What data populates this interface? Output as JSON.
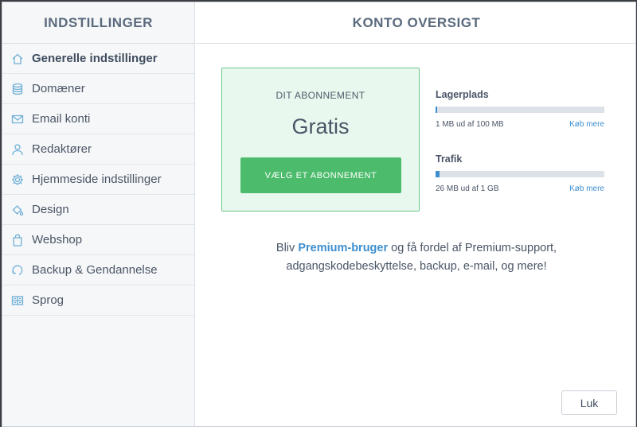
{
  "sidebar": {
    "title": "INDSTILLINGER",
    "items": [
      {
        "label": "Generelle indstillinger",
        "icon": "home-icon"
      },
      {
        "label": "Domæner",
        "icon": "database-icon"
      },
      {
        "label": "Email konti",
        "icon": "envelope-icon"
      },
      {
        "label": "Redaktører",
        "icon": "user-icon"
      },
      {
        "label": "Hjemmeside indstillinger",
        "icon": "gear-icon"
      },
      {
        "label": "Design",
        "icon": "paint-bucket-icon"
      },
      {
        "label": "Webshop",
        "icon": "shopping-bag-icon"
      },
      {
        "label": "Backup & Gendannelse",
        "icon": "backup-icon"
      },
      {
        "label": "Sprog",
        "icon": "language-icon"
      }
    ]
  },
  "main": {
    "title": "KONTO OVERSIGT",
    "plan": {
      "label": "DIT ABONNEMENT",
      "name": "Gratis",
      "button": "VÆLG ET ABONNEMENT"
    },
    "storage": {
      "title": "Lagerplads",
      "text": "1 MB ud af 100 MB",
      "link": "Køb mere",
      "fraction": 0.01
    },
    "traffic": {
      "title": "Trafik",
      "text": "26 MB ud af 1 GB",
      "link": "Køb mere",
      "fraction": 0.025
    },
    "promo": {
      "before": "Bliv ",
      "strong": "Premium-bruger",
      "after": " og få fordel af Premium-support, adgangskodebeskyttelse, backup, e-mail, og mere!"
    },
    "close": "Luk"
  },
  "colors": {
    "accent": "#3d8fd0",
    "success": "#4cbb6c",
    "plan_bg": "#e9f8ee"
  }
}
